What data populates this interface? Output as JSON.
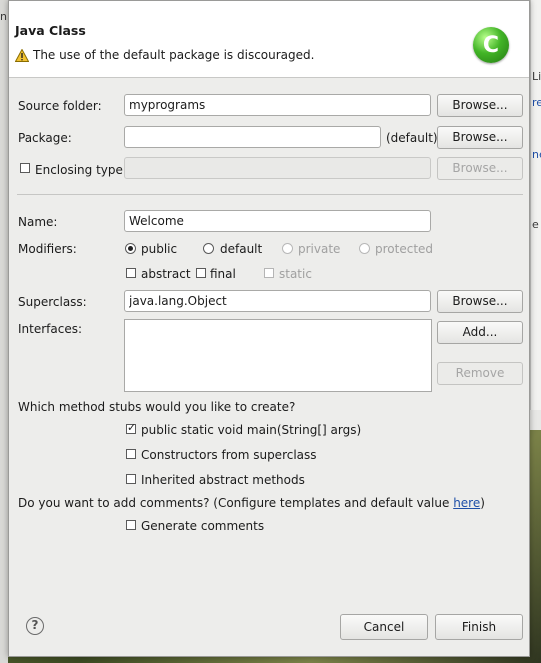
{
  "dialog": {
    "title": "Java Class",
    "message": "The use of the default package is discouraged."
  },
  "form": {
    "source_folder": {
      "label": "Source folder:",
      "value": "myprograms",
      "browse": "Browse..."
    },
    "package": {
      "label": "Package:",
      "value": "",
      "suffix": "(default)",
      "browse": "Browse..."
    },
    "enclosing_type": {
      "label": "Enclosing type:",
      "value": "",
      "browse": "Browse..."
    },
    "name": {
      "label": "Name:",
      "value": "Welcome"
    },
    "modifiers": {
      "label": "Modifiers:",
      "access": [
        "public",
        "default",
        "private",
        "protected"
      ],
      "selected": "public",
      "abstract": "abstract",
      "final": "final",
      "static": "static"
    },
    "superclass": {
      "label": "Superclass:",
      "value": "java.lang.Object",
      "browse": "Browse..."
    },
    "interfaces": {
      "label": "Interfaces:",
      "add": "Add...",
      "remove": "Remove"
    }
  },
  "stubs": {
    "question": "Which method stubs would you like to create?",
    "options": [
      {
        "label": "public static void main(String[] args)",
        "checked": true
      },
      {
        "label": "Constructors from superclass",
        "checked": false
      },
      {
        "label": "Inherited abstract methods",
        "checked": false
      }
    ]
  },
  "comments": {
    "question": "Do you want to add comments? (Configure templates and default value ",
    "link": "here",
    "question_end": ")",
    "generate": "Generate comments"
  },
  "footer": {
    "cancel": "Cancel",
    "finish": "Finish"
  },
  "background": {
    "frag1": "n",
    "frag2": "Li",
    "frag3": "ne",
    "frag4": "re",
    "frag5": "e"
  }
}
